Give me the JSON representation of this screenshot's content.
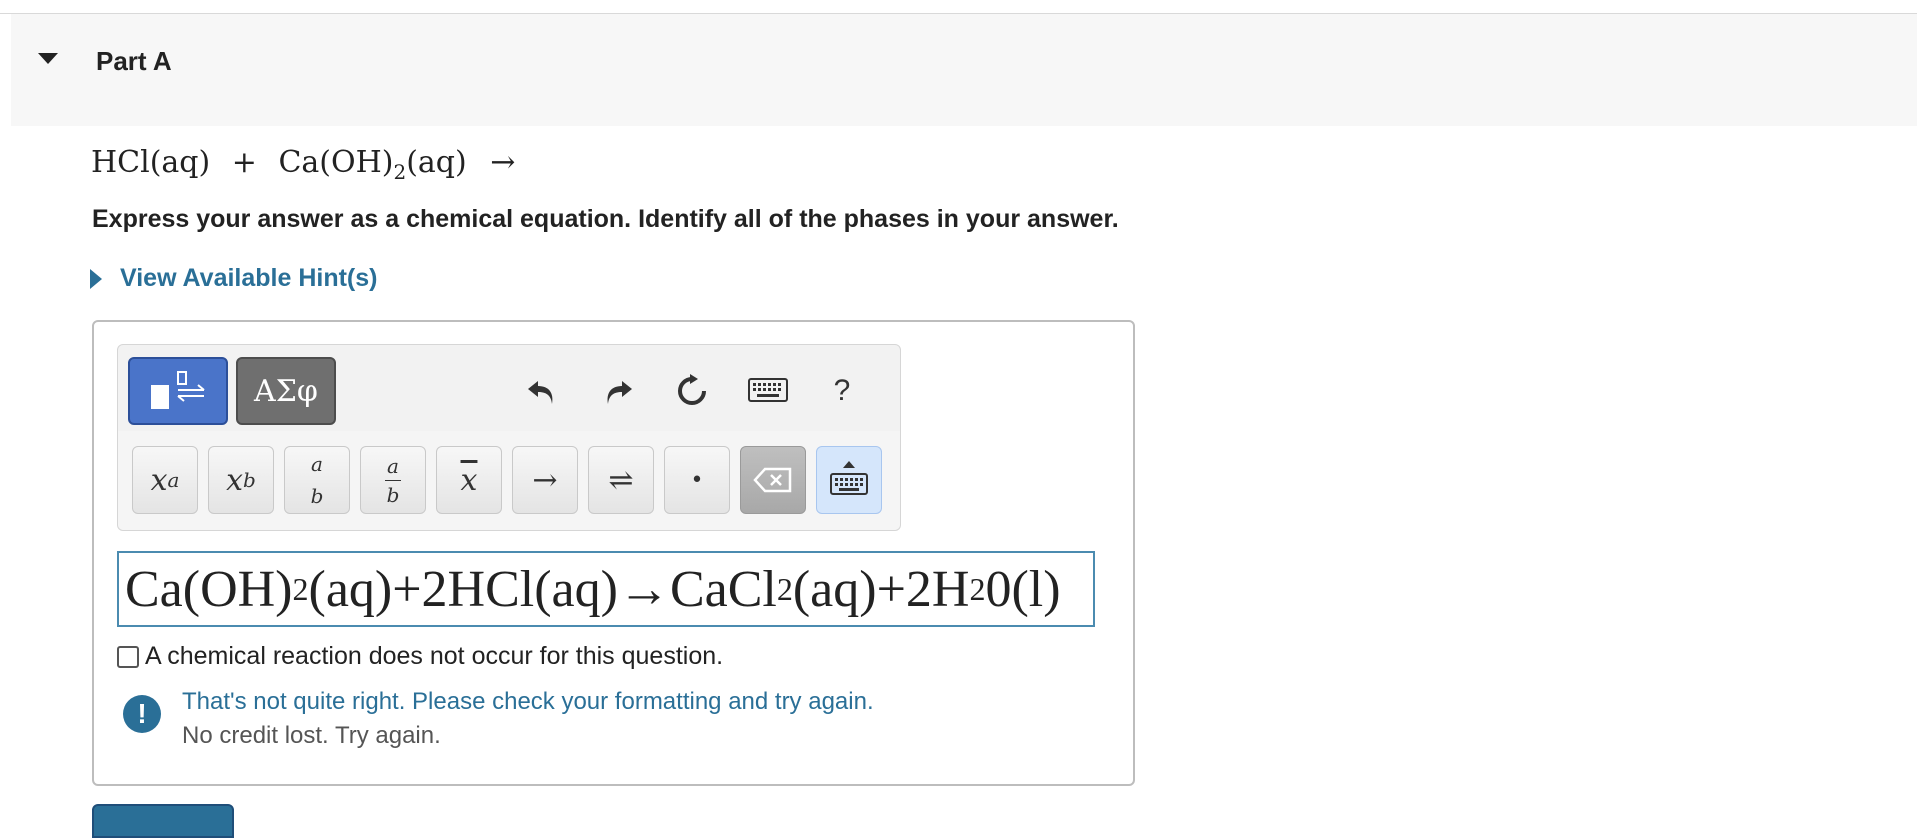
{
  "part": {
    "title": "Part A"
  },
  "question": {
    "reactant1": "HCl(aq)",
    "plus": "+",
    "reactant2_pre": "Ca(OH)",
    "reactant2_sub": "2",
    "reactant2_post": "(aq)",
    "arrow": "→",
    "instructions": "Express your answer as a chemical equation. Identify all of the phases in your answer."
  },
  "hints": {
    "label": "View Available Hint(s)"
  },
  "toolbar": {
    "greek_label": "ΑΣφ",
    "help_label": "?",
    "keys": {
      "superscript_base": "x",
      "superscript_exp": "a",
      "subscript_base": "x",
      "subscript_sub": "b",
      "frac_num": "a",
      "frac_den": "b",
      "frac_alt_num": "a",
      "frac_alt_den": "b",
      "overline": "x",
      "arrow": "→",
      "equilibrium": "⇌",
      "dot": "•"
    }
  },
  "answer": {
    "part1": "Ca(OH)",
    "sub1": "2",
    "part2": "(aq)+2HCl(aq)→CaCl",
    "sub2": "2",
    "part3": "(aq)+2H",
    "sub3": "2",
    "part4": "0(l)"
  },
  "no_reaction": {
    "label": "A chemical reaction does not occur for this question.",
    "checked": false
  },
  "feedback": {
    "icon": "!",
    "message": "That's not quite right. Please check your formatting and try again.",
    "sub": "No credit lost. Try again."
  },
  "colors": {
    "link": "#2a6f97",
    "template_button": "#4a74c9",
    "greek_button": "#6f6f6f"
  }
}
